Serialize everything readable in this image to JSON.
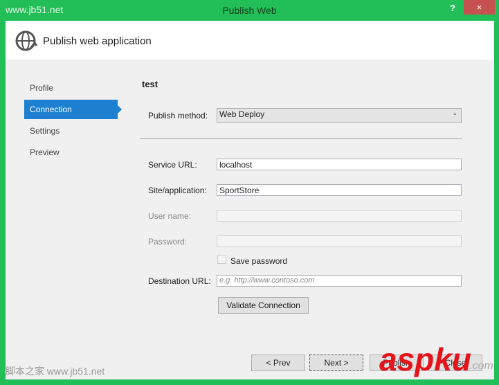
{
  "window": {
    "title": "Publish Web",
    "watermark": "www.jb51.net",
    "help": "?",
    "close": "×"
  },
  "header": {
    "title": "Publish web application"
  },
  "nav": {
    "items": [
      {
        "label": "Profile"
      },
      {
        "label": "Connection"
      },
      {
        "label": "Settings"
      },
      {
        "label": "Preview"
      }
    ]
  },
  "form": {
    "profile_name": "test",
    "publish_method_label": "Publish method:",
    "publish_method_value": "Web Deploy",
    "service_url_label": "Service URL:",
    "service_url": "localhost",
    "site_label": "Site/application:",
    "site": "SportStore",
    "user_label": "User name:",
    "user": "",
    "password_label": "Password:",
    "password": "",
    "save_password_label": "Save password",
    "destination_label": "Destination URL:",
    "destination_placeholder": "e.g. http://www.contoso.com",
    "validate_label": "Validate Connection"
  },
  "buttons": {
    "prev": "< Prev",
    "next": "Next >",
    "publish": "Publish",
    "close": "Close"
  },
  "overlay": {
    "brand": "aspku",
    "brand_suffix": ".com",
    "footer_watermark": "脚本之家 www.jb51.net"
  }
}
